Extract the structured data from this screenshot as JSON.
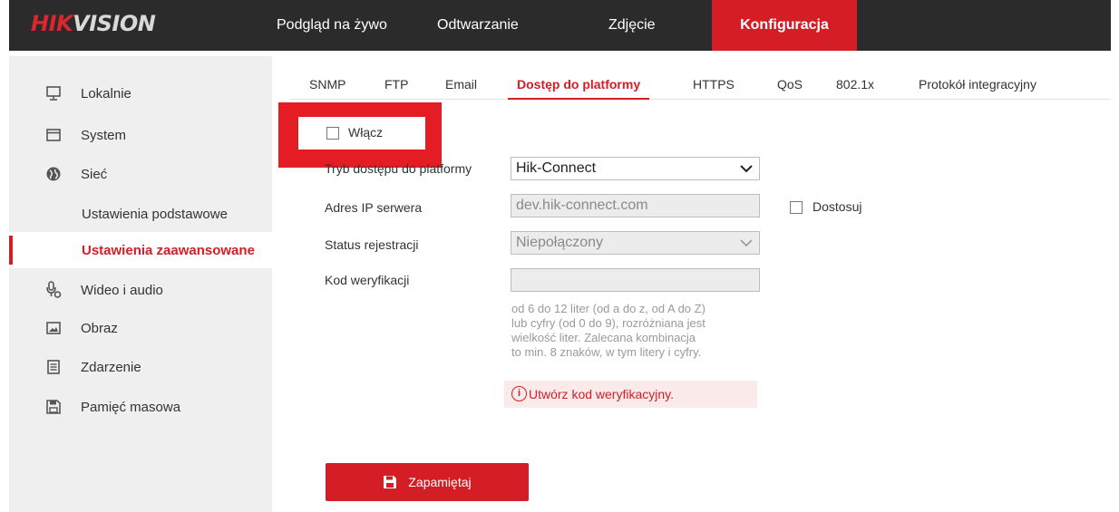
{
  "logo": {
    "part1": "HIK",
    "part2": "VISION"
  },
  "nav": {
    "items": [
      {
        "label": "Podgląd na żywo"
      },
      {
        "label": "Odtwarzanie"
      },
      {
        "label": "Zdjęcie"
      },
      {
        "label": "Konfiguracja",
        "active": true
      }
    ]
  },
  "sidebar": {
    "items": [
      {
        "label": "Lokalnie",
        "icon": "monitor-icon"
      },
      {
        "label": "System",
        "icon": "window-icon"
      },
      {
        "label": "Sieć",
        "icon": "globe-icon"
      },
      {
        "label": "Ustawienia podstawowe",
        "sub": true
      },
      {
        "label": "Ustawienia zaawansowane",
        "sub": true,
        "active": true
      },
      {
        "label": "Wideo i audio",
        "icon": "microphone-icon"
      },
      {
        "label": "Obraz",
        "icon": "image-icon"
      },
      {
        "label": "Zdarzenie",
        "icon": "calendar-icon"
      },
      {
        "label": "Pamięć masowa",
        "icon": "save-icon"
      }
    ]
  },
  "tabs": [
    {
      "label": "SNMP"
    },
    {
      "label": "FTP"
    },
    {
      "label": "Email"
    },
    {
      "label": "Dostęp do platformy",
      "active": true
    },
    {
      "label": "HTTPS"
    },
    {
      "label": "QoS"
    },
    {
      "label": "802.1x"
    },
    {
      "label": "Protokół integracyjny"
    }
  ],
  "form": {
    "enable_label": "Włącz",
    "enable_checked": false,
    "mode_label": "Tryb dostępu do platformy",
    "mode_value": "Hik-Connect",
    "server_label": "Adres IP serwera",
    "server_value": "dev.hik-connect.com",
    "custom_label": "Dostosuj",
    "custom_checked": false,
    "status_label": "Status rejestracji",
    "status_value": "Niepołączony",
    "code_label": "Kod weryfikacji",
    "code_value": "",
    "hint_lines": [
      "od 6 do 12 liter (od a do z, od A do Z)",
      "lub cyfry (od 0 do 9), rozróżniana jest",
      "wielkość liter. Zalecana kombinacja",
      "to min. 8 znaków, w tym litery i cyfry."
    ],
    "warning_text": "Utwórz kod weryfikacyjny.",
    "warning_icon": "i"
  },
  "save_label": "Zapamiętaj",
  "colors": {
    "accent": "#d51d25",
    "topbar": "#2b2b2b",
    "sidebar": "#efefef"
  }
}
